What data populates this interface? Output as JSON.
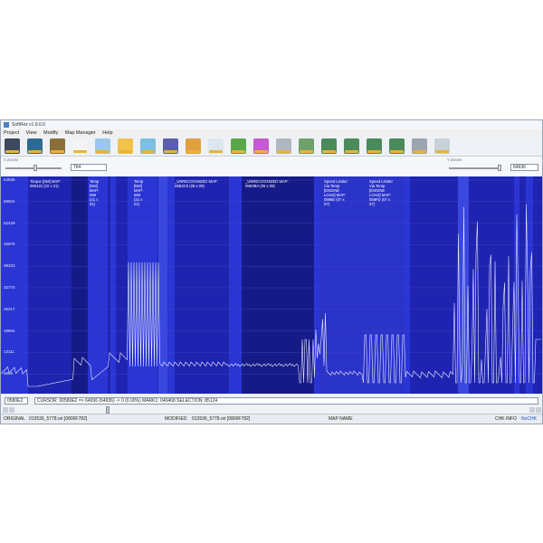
{
  "window": {
    "title": "SoftRez v1.8.0.0",
    "menu": [
      "Project",
      "View",
      "Modify",
      "Map Manager",
      "Help"
    ]
  },
  "toolbar": {
    "icons": [
      "open-project-icon",
      "compare-icon",
      "save-icon",
      "document-icon",
      "image-icon",
      "folder-icon",
      "export-icon",
      "floppy-icon",
      "pencil-icon",
      "screen-icon",
      "check-icon",
      "color-wheel-icon",
      "calculator-icon",
      "chart-icon",
      "map-tool-icon",
      "map-tool-2-icon",
      "map-tool-3-icon",
      "map-tool-4-icon",
      "pause-icon",
      "info-icon"
    ]
  },
  "zoom": {
    "x_label": "X ZOOM",
    "x_value": "764",
    "y_label": "Y ZOOM",
    "y_value": "64936"
  },
  "chart": {
    "y_ticks": [
      "64936",
      "58924",
      "52429",
      "45876",
      "39323",
      "32770",
      "26217",
      "19664",
      "13111",
      "6558"
    ],
    "columns": [
      {
        "text": "Torque [NM] MAP:\n058122 (22 x 21)"
      },
      {
        "text": "Temp\n[NM]\nMAP:\n059\n(21 x\n01)"
      },
      {
        "text": "Temp\n[NM]\nMAP:\n059\n(21 x\n01)"
      },
      {
        "text": "_UNRECOGNIZED MAP:\n05B2C0 (09 x 09)"
      },
      {
        "text": "_UNRECOGNIZED MAP:\n05E0BA (09 x 09)"
      },
      {
        "text": "Speed Limiter\nVia Temp\n[ENGINE\nLOAD] MAP:\n0596E (07 x\n07)"
      },
      {
        "text": "Speed Limiter\nVia Temp\n[ENGINE\nLOAD] MAP:\n059FD (07 x\n07)"
      }
    ]
  },
  "status": {
    "address": "0580E2",
    "cursor_line": "CURSOR: 00580E2 => 64936 (64936) -> 0 (0.00%) MARK1: 040468 SELECTION: 85124",
    "original_label": "ORIGINAL",
    "original_file": "013536_5778.ori [0800F782]",
    "modified_label": "MODIFIED",
    "modified_file": "013536_5778.ori [0800F782]",
    "map_name_label": "MAP NAME",
    "chk_info": "CHK INFO",
    "nochk": "NoCHK"
  },
  "colors": {
    "chart_bg": "#1f24b0",
    "chart_light": "#2a35d4",
    "chart_dark": "#161a86",
    "trace": "#e8e8ff",
    "menu_accent": "#e9b23a"
  }
}
